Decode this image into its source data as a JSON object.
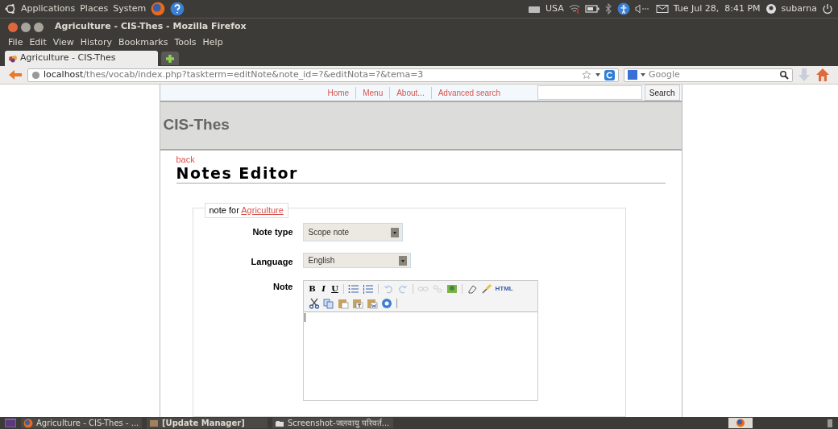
{
  "top_panel": {
    "menus": [
      "Applications",
      "Places",
      "System"
    ],
    "keyboard": "USA",
    "clock": "Tue Jul 28,  8:41 PM",
    "user": "subarna"
  },
  "window": {
    "title": "Agriculture - CIS-Thes - Mozilla Firefox"
  },
  "menu_bar": [
    "File",
    "Edit",
    "View",
    "History",
    "Bookmarks",
    "Tools",
    "Help"
  ],
  "tabs": [
    {
      "label": "Agriculture - CIS-Thes",
      "selected": true
    }
  ],
  "address_bar": {
    "host": "localhost",
    "path": "/thes/vocab/index.php?taskterm=editNote&note_id=?&editNota=?&tema=3"
  },
  "search_bar": {
    "placeholder": "Google"
  },
  "page": {
    "nav": [
      "Home",
      "Menu",
      "About...",
      "Advanced search"
    ],
    "search_button": "Search",
    "site_title": "CIS-Thes",
    "back_link": "back",
    "heading": "Notes Editor",
    "legend": {
      "prefix": "note for",
      "term": "Agriculture"
    },
    "fields": [
      {
        "label": "Note type",
        "value": "Scope note"
      },
      {
        "label": "Language",
        "value": "English"
      }
    ],
    "note_label": "Note",
    "toolbar": {
      "bold": "B",
      "italic": "I",
      "underline": "U",
      "html": "HTML"
    }
  },
  "taskbar": [
    {
      "label": "Agriculture - CIS-Thes - ...",
      "kind": "firefox"
    },
    {
      "label": "[Update Manager]",
      "kind": "update"
    },
    {
      "label": "Screenshot-जलवायु परिवर्त...",
      "kind": "screenshot"
    }
  ]
}
